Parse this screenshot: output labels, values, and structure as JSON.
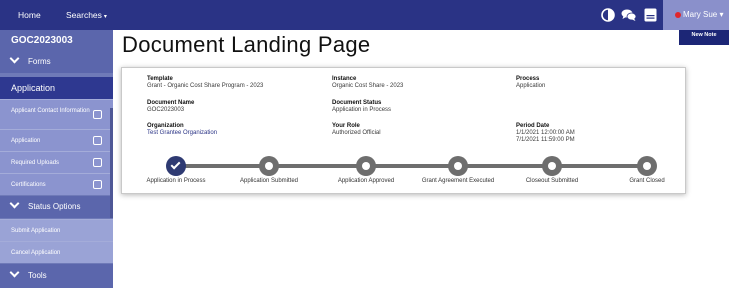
{
  "topnav": {
    "home": "Home",
    "searches": "Searches",
    "user_name": "Mary Sue",
    "new_note": "New Note",
    "icons": [
      "contrast-icon",
      "chat-icon",
      "notes-icon",
      "user-status-icon"
    ]
  },
  "sidebar": {
    "record_id": "GOC2023003",
    "forms_label": "Forms",
    "application_label": "Application",
    "items": [
      {
        "label": "Applicant Contact Information"
      },
      {
        "label": "Application"
      },
      {
        "label": "Required Uploads"
      },
      {
        "label": "Certifications"
      }
    ],
    "status_options_label": "Status Options",
    "status_items": [
      {
        "label": "Submit Application"
      },
      {
        "label": "Cancel Application"
      }
    ],
    "tools_label": "Tools"
  },
  "page": {
    "title": "Document Landing Page"
  },
  "details": {
    "template": {
      "label": "Template",
      "value": "Grant - Organic Cost Share Program - 2023"
    },
    "instance": {
      "label": "Instance",
      "value": "Organic Cost Share - 2023"
    },
    "process": {
      "label": "Process",
      "value": "Application"
    },
    "document_name": {
      "label": "Document Name",
      "value": "GOC2023003"
    },
    "document_status": {
      "label": "Document Status",
      "value": "Application in Process"
    },
    "organization": {
      "label": "Organization",
      "value": "Test Grantee Organization"
    },
    "your_role": {
      "label": "Your Role",
      "value": "Authorized Official"
    },
    "period_date": {
      "label": "Period Date",
      "start": "1/1/2021 12:00:00 AM",
      "end": "7/1/2021 11:59:00 PM"
    }
  },
  "progress": {
    "completed_steps": 1,
    "steps": [
      {
        "label": "Application in Process"
      },
      {
        "label": "Application Submitted"
      },
      {
        "label": "Application Approved"
      },
      {
        "label": "Grant Agreement Executed"
      },
      {
        "label": "Closeout Submitted"
      },
      {
        "label": "Grant Closed"
      }
    ]
  },
  "colors": {
    "nav": "#2a3385",
    "sidebar": "#6f7ab8",
    "active_step": "#2e3a72",
    "inactive_step": "#6e6e6e",
    "status_dot": "#e0262c"
  }
}
